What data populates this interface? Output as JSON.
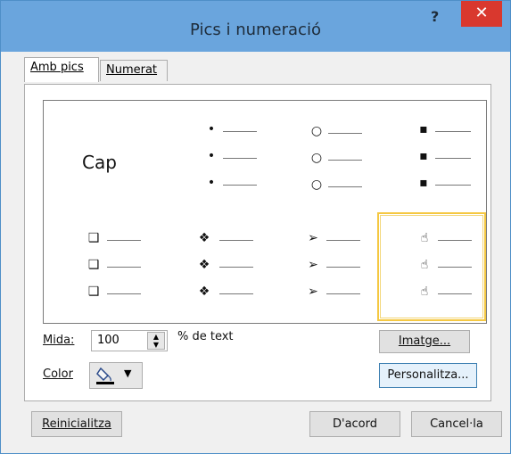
{
  "window": {
    "title": "Pics i numeració",
    "help_label": "?",
    "close_label": "✕"
  },
  "tabs": [
    {
      "label": "Amb pics",
      "active": true
    },
    {
      "label": "Numerat",
      "active": false
    }
  ],
  "gallery": {
    "none_label": "Cap",
    "bullets": {
      "r0c1": "•",
      "r0c2": "○",
      "r0c3": "▪",
      "r1c0": "❑",
      "r1c1": "❖",
      "r1c2": "➢",
      "r1c3": "☝"
    }
  },
  "size": {
    "label": "Mida:",
    "value": "100",
    "unit": "% de text"
  },
  "color": {
    "label": "Color",
    "arrow": "▼",
    "swatch": "#000000"
  },
  "buttons": {
    "picture": "Imatge...",
    "customize": "Personalitza...",
    "reset": "Reinicialitza",
    "ok": "D'acord",
    "cancel": "Cancel·la"
  }
}
